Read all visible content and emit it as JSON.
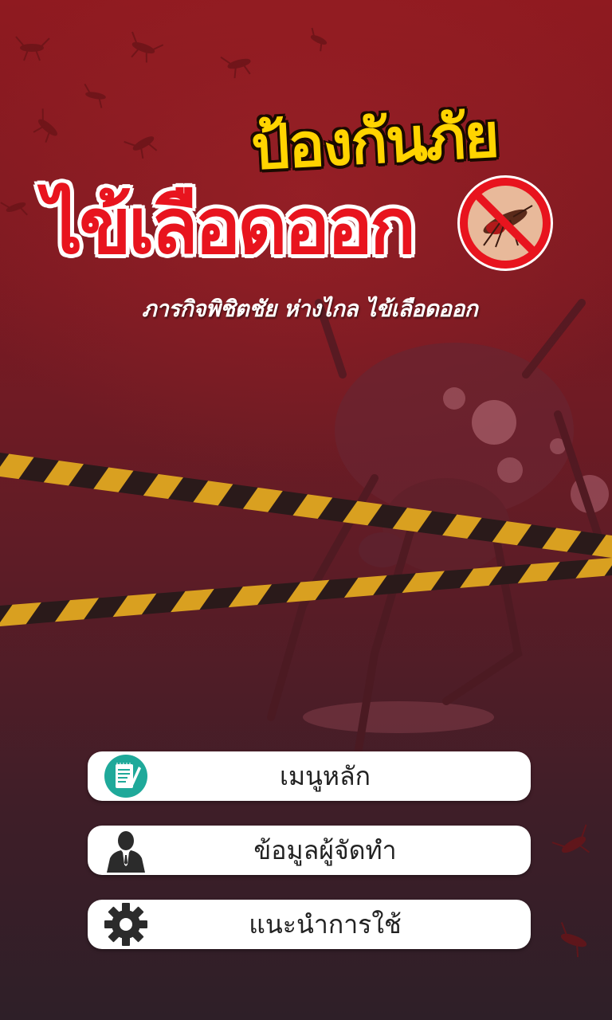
{
  "app": {
    "title_line1": "ป้องกันภัย",
    "title_line2": "ไข้เลือดออก",
    "subtitle": "ภารกิจพิชิตชัย ห่างไกล ไข้เลือดออก"
  },
  "menu": [
    {
      "label": "เมนูหลัก",
      "icon": "notepad-icon"
    },
    {
      "label": "ข้อมูลผู้จัดทำ",
      "icon": "person-icon"
    },
    {
      "label": "แนะนำการใช้",
      "icon": "gear-icon"
    }
  ],
  "colors": {
    "title_yellow": "#ffd400",
    "title_red": "#e8141e",
    "background_top": "#8f1a20",
    "background_bottom": "#2e1f28",
    "tape_yellow": "#d9a020",
    "icon_teal": "#1fa99a",
    "icon_dark": "#2b2b2b"
  }
}
